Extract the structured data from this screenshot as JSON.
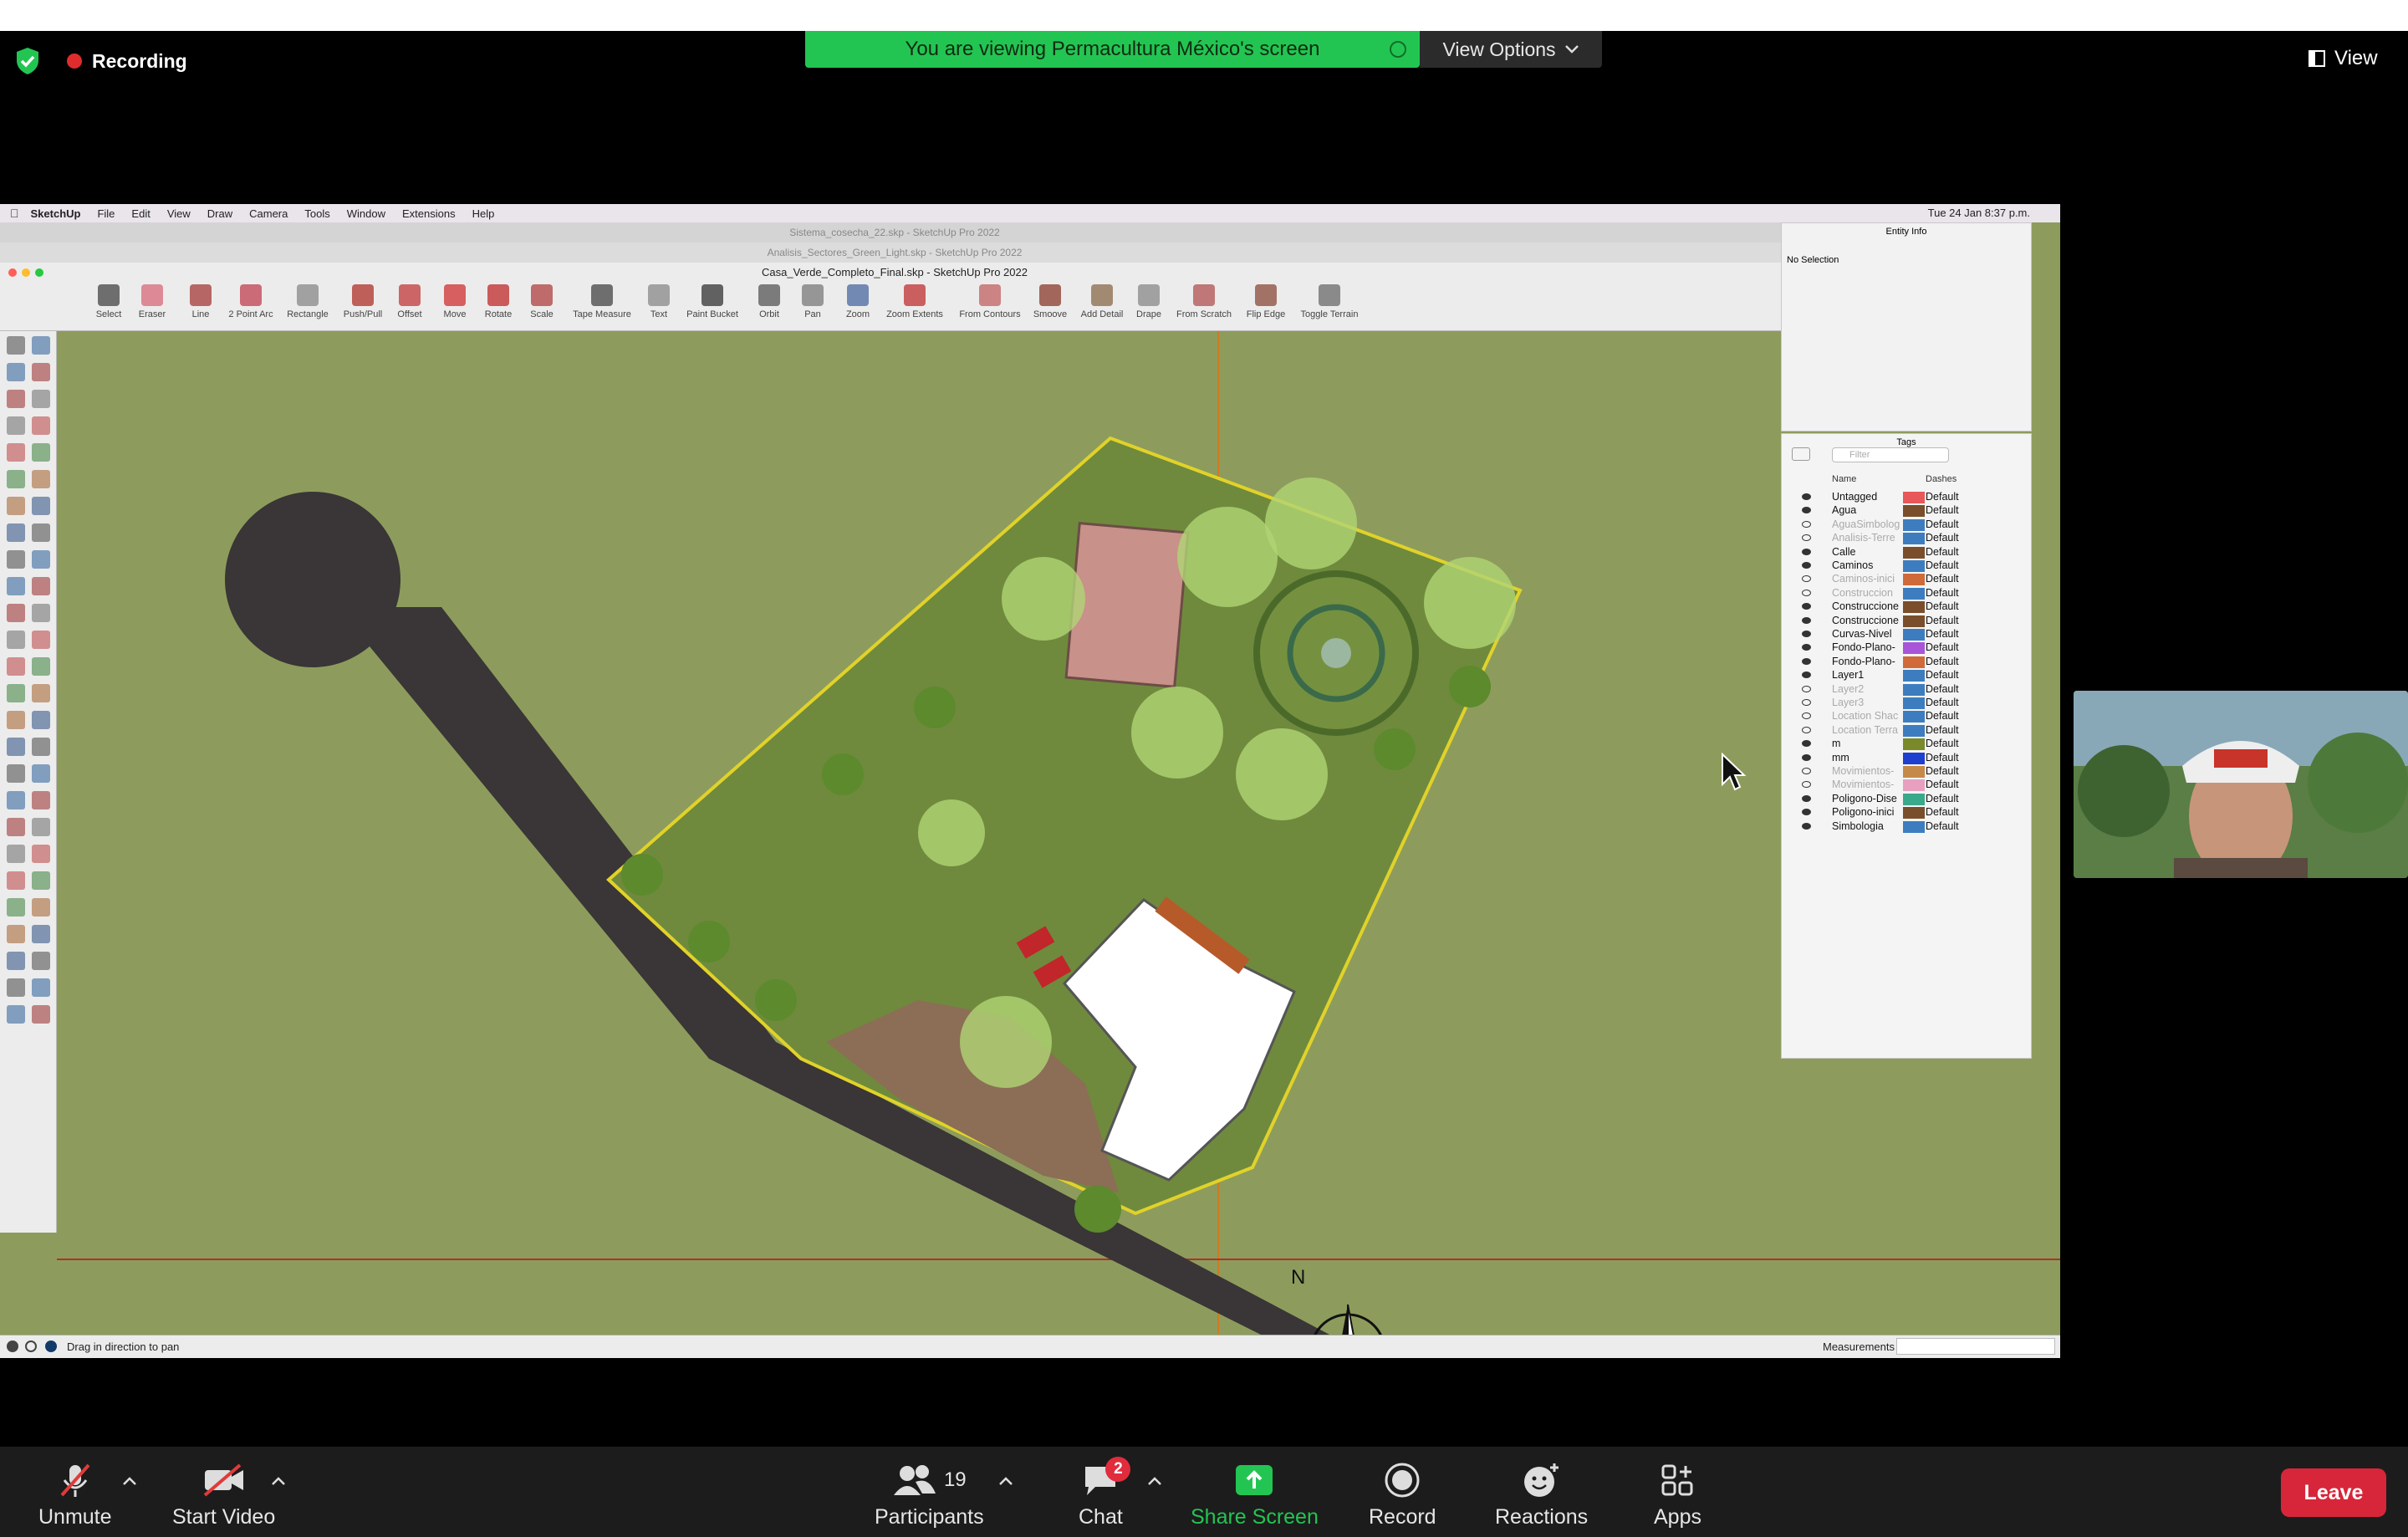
{
  "zoom": {
    "recording_label": "Recording",
    "banner_text": "You are viewing Permacultura México's screen",
    "view_options_label": "View Options",
    "view_label": "View"
  },
  "mac_menu": {
    "items": [
      "SketchUp",
      "File",
      "Edit",
      "View",
      "Draw",
      "Camera",
      "Tools",
      "Window",
      "Extensions",
      "Help"
    ],
    "clock": "Tue 24 Jan  8:37 p.m."
  },
  "windows": {
    "back_title": "Sistema_cosecha_22.skp - SketchUp Pro 2022",
    "middle_title": "Analisis_Sectores_Green_Light.skp - SketchUp Pro 2022",
    "front_title": "Casa_Verde_Completo_Final.skp - SketchUp Pro 2022"
  },
  "toolbar": {
    "tools": [
      "Select",
      "Eraser",
      "Line",
      "2 Point Arc",
      "Rectangle",
      "Push/Pull",
      "Offset",
      "Move",
      "Rotate",
      "Scale",
      "Tape Measure",
      "Text",
      "Paint Bucket",
      "Orbit",
      "Pan",
      "Zoom",
      "Zoom Extents",
      "From Contours",
      "Smoove",
      "Add Detail",
      "Drape",
      "From Scratch",
      "Flip Edge",
      "Toggle Terrain"
    ]
  },
  "entity_info": {
    "title": "Entity Info",
    "selection": "No Selection"
  },
  "tags_panel": {
    "title": "Tags",
    "filter_placeholder": "Filter",
    "col_name": "Name",
    "col_dashes": "Dashes",
    "rows": [
      {
        "name": "Untagged",
        "color": "#e8585a",
        "dashes": "Default",
        "visible": true
      },
      {
        "name": "Agua",
        "color": "#7a4e2a",
        "dashes": "Default",
        "visible": true
      },
      {
        "name": "AguaSimbolog",
        "color": "#3d7dbf",
        "dashes": "Default",
        "visible": false
      },
      {
        "name": "Analisis-Terre",
        "color": "#3d7dbf",
        "dashes": "Default",
        "visible": false
      },
      {
        "name": "Calle",
        "color": "#7a4e2a",
        "dashes": "Default",
        "visible": true
      },
      {
        "name": "Caminos",
        "color": "#3d7dbf",
        "dashes": "Default",
        "visible": true
      },
      {
        "name": "Caminos-inici",
        "color": "#d06a3a",
        "dashes": "Default",
        "visible": false
      },
      {
        "name": "Construccion",
        "color": "#3d7dbf",
        "dashes": "Default",
        "visible": false
      },
      {
        "name": "Construccione",
        "color": "#7a4e2a",
        "dashes": "Default",
        "visible": true
      },
      {
        "name": "Construccione",
        "color": "#7a4e2a",
        "dashes": "Default",
        "visible": true
      },
      {
        "name": "Curvas-Nivel",
        "color": "#3d7dbf",
        "dashes": "Default",
        "visible": true
      },
      {
        "name": "Fondo-Plano-",
        "color": "#a855d8",
        "dashes": "Default",
        "visible": true
      },
      {
        "name": "Fondo-Plano-",
        "color": "#d06a3a",
        "dashes": "Default",
        "visible": true
      },
      {
        "name": "Layer1",
        "color": "#3d7dbf",
        "dashes": "Default",
        "visible": true
      },
      {
        "name": "Layer2",
        "color": "#3d7dbf",
        "dashes": "Default",
        "visible": false
      },
      {
        "name": "Layer3",
        "color": "#3d7dbf",
        "dashes": "Default",
        "visible": false
      },
      {
        "name": "Location Shac",
        "color": "#3d7dbf",
        "dashes": "Default",
        "visible": false
      },
      {
        "name": "Location Terra",
        "color": "#3d7dbf",
        "dashes": "Default",
        "visible": false
      },
      {
        "name": "m",
        "color": "#7a8a2a",
        "dashes": "Default",
        "visible": true
      },
      {
        "name": "mm",
        "color": "#1f3fd0",
        "dashes": "Default",
        "visible": true
      },
      {
        "name": "Movimientos-",
        "color": "#c58a4a",
        "dashes": "Default",
        "visible": false
      },
      {
        "name": "Movimientos-",
        "color": "#e8a0c0",
        "dashes": "Default",
        "visible": false
      },
      {
        "name": "Poligono-Dise",
        "color": "#3aa88a",
        "dashes": "Default",
        "visible": true
      },
      {
        "name": "Poligono-inici",
        "color": "#7a4e2a",
        "dashes": "Default",
        "visible": true
      },
      {
        "name": "Simbologia",
        "color": "#3d7dbf",
        "dashes": "Default",
        "visible": true
      }
    ]
  },
  "compass_label": "N",
  "status": {
    "hint": "Drag in direction to pan",
    "measurements_label": "Measurements"
  },
  "bottom_bar": {
    "unmute": "Unmute",
    "start_video": "Start Video",
    "participants": "Participants",
    "participants_count": "19",
    "chat": "Chat",
    "chat_badge": "2",
    "share_screen": "Share Screen",
    "record": "Record",
    "reactions": "Reactions",
    "apps": "Apps",
    "leave": "Leave"
  }
}
